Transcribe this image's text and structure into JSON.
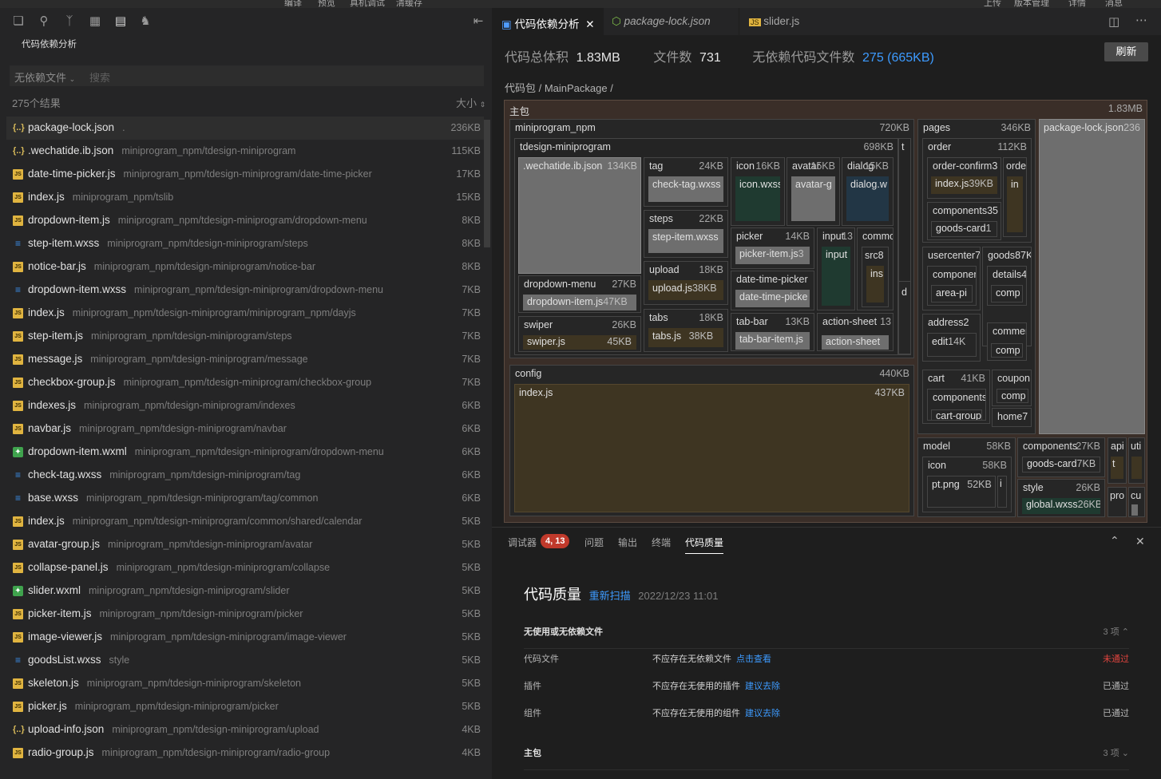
{
  "menubar": [
    "编译",
    "预览",
    "真机调试",
    "清缓存",
    "上传",
    "版本管理",
    "详情",
    "消息"
  ],
  "left_panel": {
    "title": "代码依赖分析",
    "filter_select": "无依赖文件",
    "search_placeholder": "搜索",
    "result_count": "275个结果",
    "sort_label": "大小",
    "files": [
      {
        "name": "package-lock.json",
        "path": ".",
        "size": "236KB",
        "type": "json"
      },
      {
        "name": ".wechatide.ib.json",
        "path": "miniprogram_npm/tdesign-miniprogram",
        "size": "115KB",
        "type": "json"
      },
      {
        "name": "date-time-picker.js",
        "path": "miniprogram_npm/tdesign-miniprogram/date-time-picker",
        "size": "17KB",
        "type": "js"
      },
      {
        "name": "index.js",
        "path": "miniprogram_npm/tslib",
        "size": "15KB",
        "type": "js"
      },
      {
        "name": "dropdown-item.js",
        "path": "miniprogram_npm/tdesign-miniprogram/dropdown-menu",
        "size": "8KB",
        "type": "js"
      },
      {
        "name": "step-item.wxss",
        "path": "miniprogram_npm/tdesign-miniprogram/steps",
        "size": "8KB",
        "type": "wxss"
      },
      {
        "name": "notice-bar.js",
        "path": "miniprogram_npm/tdesign-miniprogram/notice-bar",
        "size": "8KB",
        "type": "js"
      },
      {
        "name": "dropdown-item.wxss",
        "path": "miniprogram_npm/tdesign-miniprogram/dropdown-menu",
        "size": "7KB",
        "type": "wxss"
      },
      {
        "name": "index.js",
        "path": "miniprogram_npm/tdesign-miniprogram/miniprogram_npm/dayjs",
        "size": "7KB",
        "type": "js"
      },
      {
        "name": "step-item.js",
        "path": "miniprogram_npm/tdesign-miniprogram/steps",
        "size": "7KB",
        "type": "js"
      },
      {
        "name": "message.js",
        "path": "miniprogram_npm/tdesign-miniprogram/message",
        "size": "7KB",
        "type": "js"
      },
      {
        "name": "checkbox-group.js",
        "path": "miniprogram_npm/tdesign-miniprogram/checkbox-group",
        "size": "7KB",
        "type": "js"
      },
      {
        "name": "indexes.js",
        "path": "miniprogram_npm/tdesign-miniprogram/indexes",
        "size": "6KB",
        "type": "js"
      },
      {
        "name": "navbar.js",
        "path": "miniprogram_npm/tdesign-miniprogram/navbar",
        "size": "6KB",
        "type": "js"
      },
      {
        "name": "dropdown-item.wxml",
        "path": "miniprogram_npm/tdesign-miniprogram/dropdown-menu",
        "size": "6KB",
        "type": "wxml"
      },
      {
        "name": "check-tag.wxss",
        "path": "miniprogram_npm/tdesign-miniprogram/tag",
        "size": "6KB",
        "type": "wxss"
      },
      {
        "name": "base.wxss",
        "path": "miniprogram_npm/tdesign-miniprogram/tag/common",
        "size": "6KB",
        "type": "wxss"
      },
      {
        "name": "index.js",
        "path": "miniprogram_npm/tdesign-miniprogram/common/shared/calendar",
        "size": "5KB",
        "type": "js"
      },
      {
        "name": "avatar-group.js",
        "path": "miniprogram_npm/tdesign-miniprogram/avatar",
        "size": "5KB",
        "type": "js"
      },
      {
        "name": "collapse-panel.js",
        "path": "miniprogram_npm/tdesign-miniprogram/collapse",
        "size": "5KB",
        "type": "js"
      },
      {
        "name": "slider.wxml",
        "path": "miniprogram_npm/tdesign-miniprogram/slider",
        "size": "5KB",
        "type": "wxml"
      },
      {
        "name": "picker-item.js",
        "path": "miniprogram_npm/tdesign-miniprogram/picker",
        "size": "5KB",
        "type": "js"
      },
      {
        "name": "image-viewer.js",
        "path": "miniprogram_npm/tdesign-miniprogram/image-viewer",
        "size": "5KB",
        "type": "js"
      },
      {
        "name": "goodsList.wxss",
        "path": "style",
        "size": "5KB",
        "type": "wxss"
      },
      {
        "name": "skeleton.js",
        "path": "miniprogram_npm/tdesign-miniprogram/skeleton",
        "size": "5KB",
        "type": "js"
      },
      {
        "name": "picker.js",
        "path": "miniprogram_npm/tdesign-miniprogram/picker",
        "size": "5KB",
        "type": "js"
      },
      {
        "name": "upload-info.json",
        "path": "miniprogram_npm/tdesign-miniprogram/upload",
        "size": "4KB",
        "type": "json"
      },
      {
        "name": "radio-group.js",
        "path": "miniprogram_npm/tdesign-miniprogram/radio-group",
        "size": "4KB",
        "type": "js"
      }
    ]
  },
  "tabs": [
    {
      "label": "代码依赖分析",
      "active": true
    },
    {
      "label": "package-lock.json",
      "active": false
    },
    {
      "label": "slider.js",
      "active": false
    }
  ],
  "stats": {
    "total_label": "代码总体积",
    "total_value": "1.83MB",
    "files_label": "文件数",
    "files_value": "731",
    "nodep_label": "无依赖代码文件数",
    "nodep_value": "275 (665KB)",
    "refresh": "刷新"
  },
  "breadcrumb": "代码包 / MainPackage /",
  "treemap": {
    "main": {
      "name": "主包",
      "size": "1.83MB"
    },
    "npm": {
      "name": "miniprogram_npm",
      "size": "720KB"
    },
    "tdesign": {
      "name": "tdesign-miniprogram",
      "size": "698KB"
    },
    "t_col": "t",
    "wechatide": {
      "name": ".wechatide.ib.json",
      "size": "134KB"
    },
    "tag": {
      "name": "tag",
      "size": "24KB",
      "leaf": "check-tag.wxss"
    },
    "icon": {
      "name": "icon",
      "size": "16KB",
      "leaf": "icon.wxss"
    },
    "avatar": {
      "name": "avatar",
      "size": "15KB",
      "leaf": "avatar-g"
    },
    "dialog": {
      "name": "dialog",
      "size": "15KB",
      "leaf": "dialog.w"
    },
    "steps": {
      "name": "steps",
      "size": "22KB",
      "leaf": "step-item.wxss"
    },
    "picker": {
      "name": "picker",
      "size": "14KB",
      "leaf": "picker-item.js",
      "leaf_size": "3"
    },
    "input": {
      "name": "input",
      "size": "13",
      "leaf": "input"
    },
    "common": {
      "name": "commo",
      "src": "src",
      "src_size": "8",
      "ins": "ins"
    },
    "upload": {
      "name": "upload",
      "size": "18KB",
      "leaf": "upload.js",
      "leaf_size": "38KB"
    },
    "dtp": {
      "name": "date-time-picker",
      "leaf": "date-time-picke"
    },
    "dropdown": {
      "name": "dropdown-menu",
      "size": "27KB",
      "leaf": "dropdown-item.js",
      "leaf_size": "47KB"
    },
    "tabs": {
      "name": "tabs",
      "size": "18KB",
      "leaf": "tabs.js",
      "leaf_size": "38KB"
    },
    "swiper": {
      "name": "swiper",
      "size": "26KB",
      "leaf": "swiper.js",
      "leaf_size": "45KB"
    },
    "tabbar": {
      "name": "tab-bar",
      "size": "13KB",
      "leaf": "tab-bar-item.js"
    },
    "actionsheet": {
      "name": "action-sheet",
      "size": "13",
      "leaf": "action-sheet"
    },
    "d_col": "d",
    "config": {
      "name": "config",
      "size": "440KB",
      "leaf": "index.js",
      "leaf_size": "437KB"
    },
    "pages": {
      "name": "pages",
      "size": "346KB"
    },
    "order": {
      "name": "order",
      "size": "112KB"
    },
    "order_confirm": {
      "name": "order-confirm",
      "size": "3",
      "leaf": "index.js",
      "leaf_size": "39KB"
    },
    "orde": {
      "name": "orde",
      "leaf": "in"
    },
    "components_a": {
      "name": "components",
      "size": "35",
      "leaf": "goods-card",
      "leaf_size": "1"
    },
    "usercenter": {
      "name": "usercenter",
      "size": "7"
    },
    "componen": {
      "name": "componer",
      "leaf": "area-pi"
    },
    "goods": {
      "name": "goods",
      "size": "87K"
    },
    "details": {
      "name": "details",
      "size": "4",
      "leaf": "comp"
    },
    "address": {
      "name": "address",
      "size": "2",
      "leaf": "edit",
      "leaf_size": "14K"
    },
    "commen": {
      "name": "commen",
      "leaf": "comp"
    },
    "cart": {
      "name": "cart",
      "size": "41KB",
      "sub": "components",
      "leaf": "cart-group"
    },
    "coupon": {
      "name": "coupon",
      "sub": "comp"
    },
    "home": {
      "name": "home",
      "size": "7"
    },
    "pkglock": {
      "name": "package-lock.json",
      "size": "236"
    },
    "model": {
      "name": "model",
      "size": "58KB"
    },
    "icon2": {
      "name": "icon",
      "size": "58KB",
      "leaf": "pt.png",
      "leaf_size": "52KB",
      "extra": "i"
    },
    "components_b": {
      "name": "components",
      "size": "27KB",
      "leaf": "goods-card",
      "leaf_size": "7KB"
    },
    "style": {
      "name": "style",
      "size": "26KB",
      "leaf": "global.wxss",
      "leaf_size": "26KB"
    },
    "api": {
      "name": "api",
      "leaf": "t"
    },
    "uti": {
      "name": "uti"
    },
    "pro": {
      "name": "pro"
    },
    "cu": {
      "name": "cu"
    }
  },
  "bottom": {
    "tabs": [
      "调试器",
      "问题",
      "输出",
      "终端",
      "代码质量"
    ],
    "badge": "4, 13",
    "heading": "代码质量",
    "rescan": "重新扫描",
    "timestamp": "2022/12/23 11:01",
    "section1": "无使用或无依赖文件",
    "section1_count": "3 项",
    "rows": [
      {
        "label": "代码文件",
        "desc": "不应存在无依赖文件",
        "link": "点击查看",
        "status": "未通过"
      },
      {
        "label": "插件",
        "desc": "不应存在无使用的插件",
        "link": "建议去除",
        "status": "已通过"
      },
      {
        "label": "组件",
        "desc": "不应存在无使用的组件",
        "link": "建议去除",
        "status": "已通过"
      }
    ],
    "section2": "主包",
    "section2_count": "3 项"
  }
}
